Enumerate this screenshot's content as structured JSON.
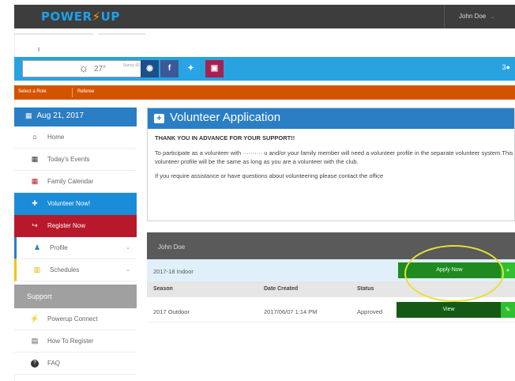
{
  "header": {
    "logo_left": "POWER",
    "logo_bolt": "⚡",
    "logo_right": "UP",
    "user_name": "John Doe",
    "user_caret": "⌄",
    "help_icon": "help-circle-icon"
  },
  "blue_bar": {
    "weather_icon": "sun-icon",
    "temperature": "27°",
    "condition": "Sunny 60.5F",
    "social": [
      "◉",
      "f",
      "🐦",
      "▣"
    ],
    "social_icons": [
      "powerup-icon",
      "facebook-icon",
      "twitter-icon",
      "instagram-icon"
    ],
    "right_icon": "3●"
  },
  "orange_bar": {
    "select_role": "Select a Role",
    "referee": "Referee"
  },
  "sidebar": {
    "date": "Aug 21, 2017",
    "items": [
      {
        "label": "Home",
        "icon": "🏠",
        "icon_name": "home-icon"
      },
      {
        "label": "Today's Events",
        "icon": "▦",
        "icon_name": "calendar-icon"
      },
      {
        "label": "Family Calendar",
        "icon": "▦",
        "icon_name": "family-calendar-icon"
      },
      {
        "label": "Volunteer Now!",
        "icon": "✚",
        "icon_name": "volunteer-icon"
      },
      {
        "label": "Register Now",
        "icon": "↪",
        "icon_name": "register-icon"
      },
      {
        "label": "Profile",
        "icon": "👤",
        "icon_name": "profile-icon"
      },
      {
        "label": "Schedules",
        "icon": "▥",
        "icon_name": "schedules-icon"
      }
    ],
    "support_label": "Support",
    "support_items": [
      {
        "label": "Powerup Connect",
        "icon": "⚡",
        "icon_name": "connect-icon"
      },
      {
        "label": "How To Register",
        "icon": "▤",
        "icon_name": "document-icon"
      },
      {
        "label": "FAQ",
        "icon": "?",
        "icon_name": "faq-icon"
      }
    ]
  },
  "panel": {
    "title": "Volunteer Application",
    "thanks": "THANK YOU IN ADVANCE FOR YOUR SUPPORT!!",
    "para1": "To participate as a volunteer with                    ··········  u and/or your family member will need a volunteer profile in the separate volunteer system.This volunteer profile will be the same as long as you are a volunteer with the club.",
    "para2": "If you require assistance or have questions about volunteering please contact the office"
  },
  "registrations": {
    "name": "John Doe",
    "pending_season": "2017-18 Indoor",
    "apply_label": "Apply Now",
    "apply_side": "+",
    "columns": [
      "Season",
      "Date Created",
      "Status"
    ],
    "rows": [
      {
        "season": "2017 Outdoor",
        "date": "2017/06/07 1:14 PM",
        "status": "Approved",
        "action": "View",
        "action_side": "✎"
      }
    ]
  }
}
